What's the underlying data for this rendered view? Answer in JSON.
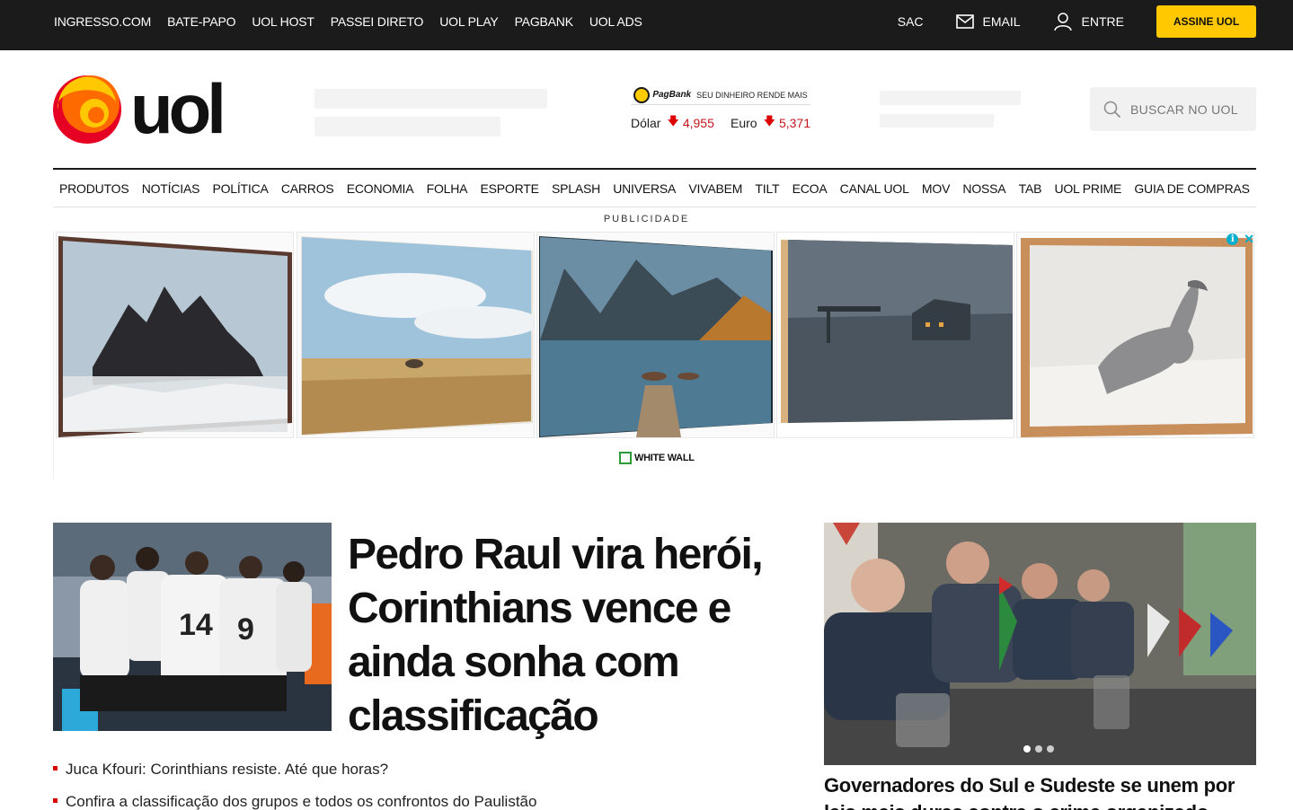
{
  "topbar": {
    "links": [
      "INGRESSO.COM",
      "BATE-PAPO",
      "UOL HOST",
      "PASSEI DIRETO",
      "UOL PLAY",
      "PAGBANK",
      "UOL ADS"
    ],
    "sac": "SAC",
    "email": "EMAIL",
    "login": "ENTRE",
    "subscribe": "ASSINE UOL",
    "subscribe_color": "#ffc800",
    "background": "#1b1b1b"
  },
  "header": {
    "logo_text": "uol",
    "currency": {
      "sponsor": "PagBank",
      "tagline": "SEU DINHEIRO RENDE MAIS",
      "rates": [
        {
          "label": "Dólar",
          "value": "4,955",
          "direction": "down"
        },
        {
          "label": "Euro",
          "value": "5,371",
          "direction": "down"
        }
      ]
    },
    "search_placeholder": "BUSCAR NO UOL"
  },
  "nav": {
    "items": [
      "PRODUTOS",
      "NOTÍCIAS",
      "POLÍTICA",
      "CARROS",
      "ECONOMIA",
      "FOLHA",
      "ESPORTE",
      "SPLASH",
      "UNIVERSA",
      "VIVABEM",
      "TILT",
      "ECOA",
      "CANAL UOL",
      "MOV",
      "NOSSA",
      "TAB",
      "UOL PRIME",
      "GUIA DE COMPRAS"
    ]
  },
  "ad": {
    "label": "PUBLICIDADE",
    "brand": "WHITE WALL",
    "tiles": [
      "mountain-peaks-fog",
      "savanna-sky",
      "lake-mountains-boats",
      "foggy-station",
      "white-horse"
    ],
    "info_icon": "ad-info-icon",
    "close_icon": "ad-close-icon"
  },
  "main": {
    "lead": {
      "headline": "Pedro Raul vira herói, Corinthians vence e ainda sonha com classificação",
      "image": "corinthians-players-celebrating"
    },
    "related": [
      "Juca Kfouri: Corinthians resiste. Até que horas?",
      "Confira a classificação dos grupos e todos os confrontos do Paulistão"
    ],
    "side": {
      "image": "governors-meeting",
      "title": "Governadores do Sul e Sudeste se unem por leis mais duras contra o crime organizado",
      "carousel_dots": 3,
      "active_dot": 1
    }
  },
  "colors": {
    "accent_red": "#c4161c",
    "logo_yellow": "#ffc800",
    "logo_orange": "#ff6a00",
    "logo_red": "#e60024"
  }
}
